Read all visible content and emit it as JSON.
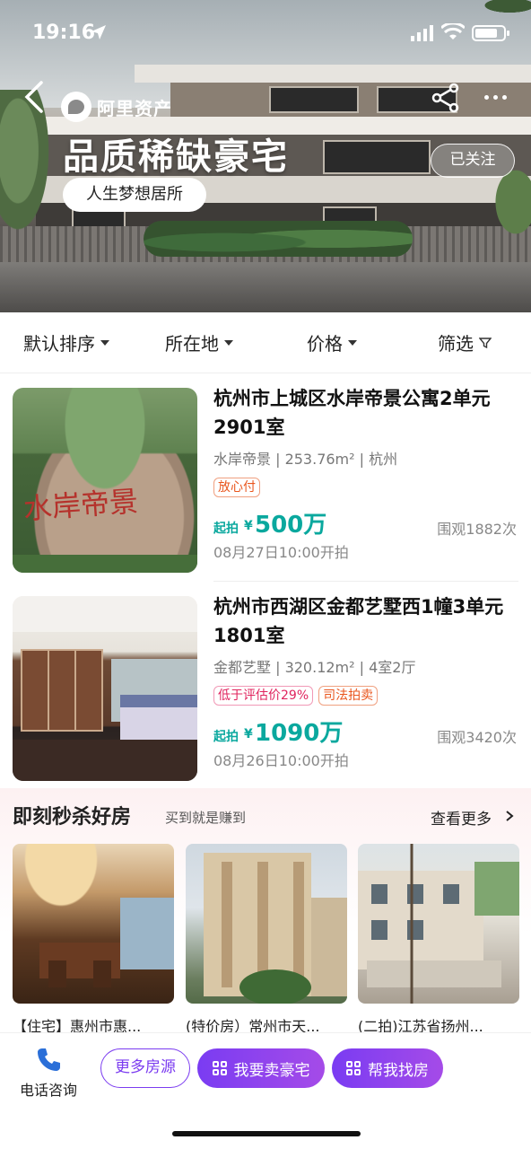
{
  "status_bar": {
    "time": "19:16"
  },
  "hero": {
    "brand": "阿里资产",
    "title": "品质稀缺豪宅",
    "tagline": "人生梦想居所",
    "follow_label": "已关注"
  },
  "filters": [
    {
      "label": "默认排序",
      "icon": "caret-down-icon"
    },
    {
      "label": "所在地",
      "icon": "caret-down-icon"
    },
    {
      "label": "价格",
      "icon": "caret-down-icon"
    },
    {
      "label": "筛选",
      "icon": "filter-icon"
    }
  ],
  "listings": [
    {
      "title": "杭州市上城区水岸帝景公寓2单元2901室",
      "meta": "水岸帝景 | 253.76m² | 杭州",
      "badges": [
        {
          "text": "放心付",
          "color": "orange"
        }
      ],
      "start_label": "起拍",
      "currency": "¥",
      "price": "500万",
      "views": "围观1882次",
      "date": "08月27日10:00开拍"
    },
    {
      "title": "杭州市西湖区金都艺墅西1幢3单元1801室",
      "meta": "金都艺墅 | 320.12m² | 4室2厅",
      "badges": [
        {
          "text": "低于评估价29%",
          "color": "pink"
        },
        {
          "text": "司法拍卖",
          "color": "orange"
        }
      ],
      "start_label": "起拍",
      "currency": "¥",
      "price": "1090万",
      "views": "围观3420次",
      "date": "08月26日10:00开拍"
    }
  ],
  "flash_sale": {
    "title": "即刻秒杀好房",
    "subtitle": "买到就是赚到",
    "more_label": "查看更多",
    "cards": [
      {
        "caption": "【住宅】惠州市惠..."
      },
      {
        "caption": "(特价房）常州市天..."
      },
      {
        "caption": "(二拍)江苏省扬州..."
      }
    ]
  },
  "bottom_bar": {
    "phone_label": "电话咨询",
    "more_listings": "更多房源",
    "sell_label": "我要卖豪宅",
    "find_label": "帮我找房"
  },
  "colors": {
    "accent": "#0aa89e",
    "brand_purple": "#7b3cf0"
  }
}
